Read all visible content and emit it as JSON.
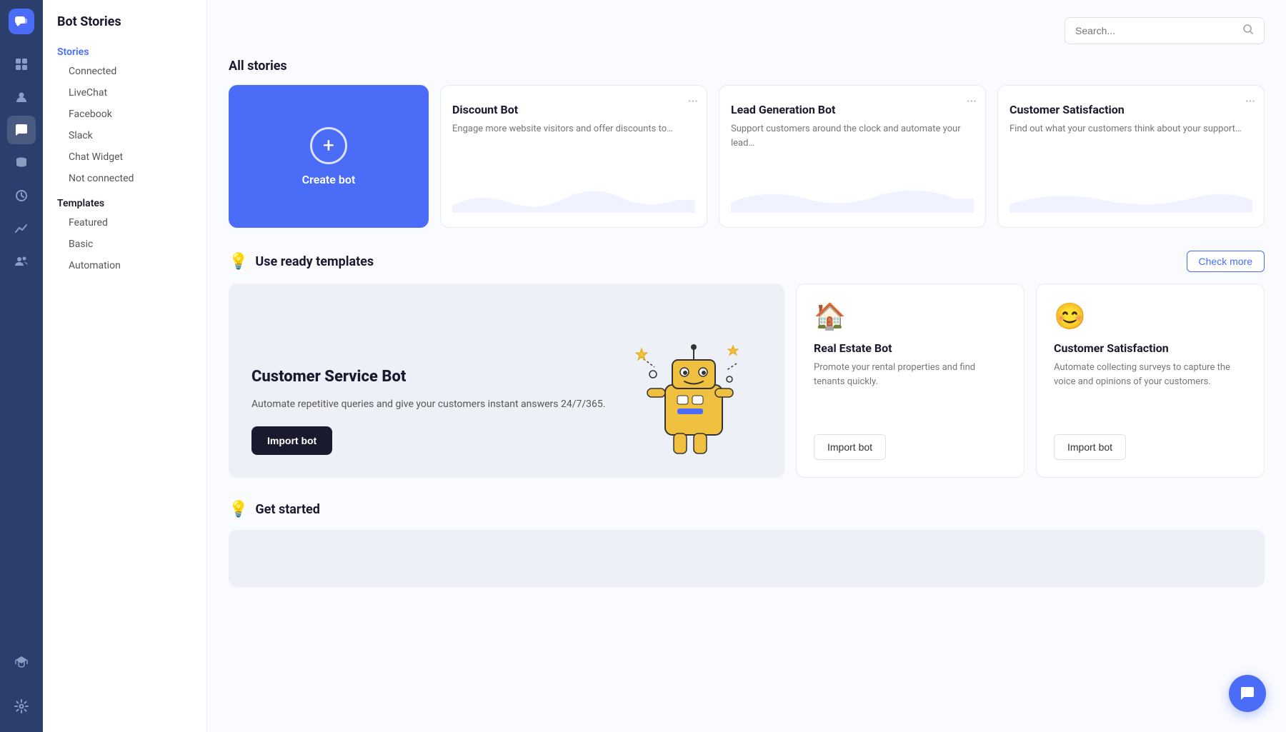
{
  "app": {
    "title": "Bot Stories"
  },
  "icon_nav": {
    "items": [
      {
        "name": "dashboard-icon",
        "icon": "⊞",
        "active": false
      },
      {
        "name": "contacts-icon",
        "icon": "👥",
        "active": false
      },
      {
        "name": "chat-icon",
        "icon": "💬",
        "active": false
      },
      {
        "name": "database-icon",
        "icon": "🗄",
        "active": false
      },
      {
        "name": "clock-icon",
        "icon": "🕐",
        "active": false
      },
      {
        "name": "analytics-icon",
        "icon": "📈",
        "active": true
      },
      {
        "name": "team-icon",
        "icon": "👤",
        "active": false
      }
    ],
    "bottom_items": [
      {
        "name": "academy-icon",
        "icon": "🎓"
      },
      {
        "name": "settings-icon",
        "icon": "⚙"
      }
    ]
  },
  "sidebar": {
    "title": "Bot Stories",
    "stories_label": "Stories",
    "connected_label": "Connected",
    "sub_items": [
      {
        "label": "LiveChat"
      },
      {
        "label": "Facebook"
      },
      {
        "label": "Slack"
      },
      {
        "label": "Chat Widget"
      }
    ],
    "not_connected_label": "Not connected",
    "templates_label": "Templates",
    "template_sub_items": [
      {
        "label": "Featured"
      },
      {
        "label": "Basic"
      },
      {
        "label": "Automation"
      }
    ]
  },
  "search": {
    "placeholder": "Search..."
  },
  "all_stories": {
    "title": "All stories",
    "create_bot_label": "Create bot",
    "cards": [
      {
        "title": "Discount Bot",
        "description": "Engage more website visitors and offer discounts to…"
      },
      {
        "title": "Lead Generation Bot",
        "description": "Support customers around the clock and automate your lead…"
      },
      {
        "title": "Customer Satisfaction",
        "description": "Find out what your customers think about your support…"
      }
    ]
  },
  "templates": {
    "section_title": "Use ready templates",
    "check_more_label": "Check more",
    "featured": {
      "title": "Customer Service Bot",
      "description": "Automate repetitive queries and give your customers instant answers 24/7/365.",
      "import_label": "Import bot"
    },
    "small_cards": [
      {
        "icon": "🏠",
        "title": "Real Estate Bot",
        "description": "Promote your rental properties and find tenants quickly.",
        "import_label": "Import bot"
      },
      {
        "icon": "😊",
        "title": "Customer Satisfaction",
        "description": "Automate collecting surveys to capture the voice and opinions of your customers.",
        "import_label": "Import bot"
      }
    ]
  },
  "get_started": {
    "title": "Get started"
  },
  "fab": {
    "icon": "💬"
  }
}
